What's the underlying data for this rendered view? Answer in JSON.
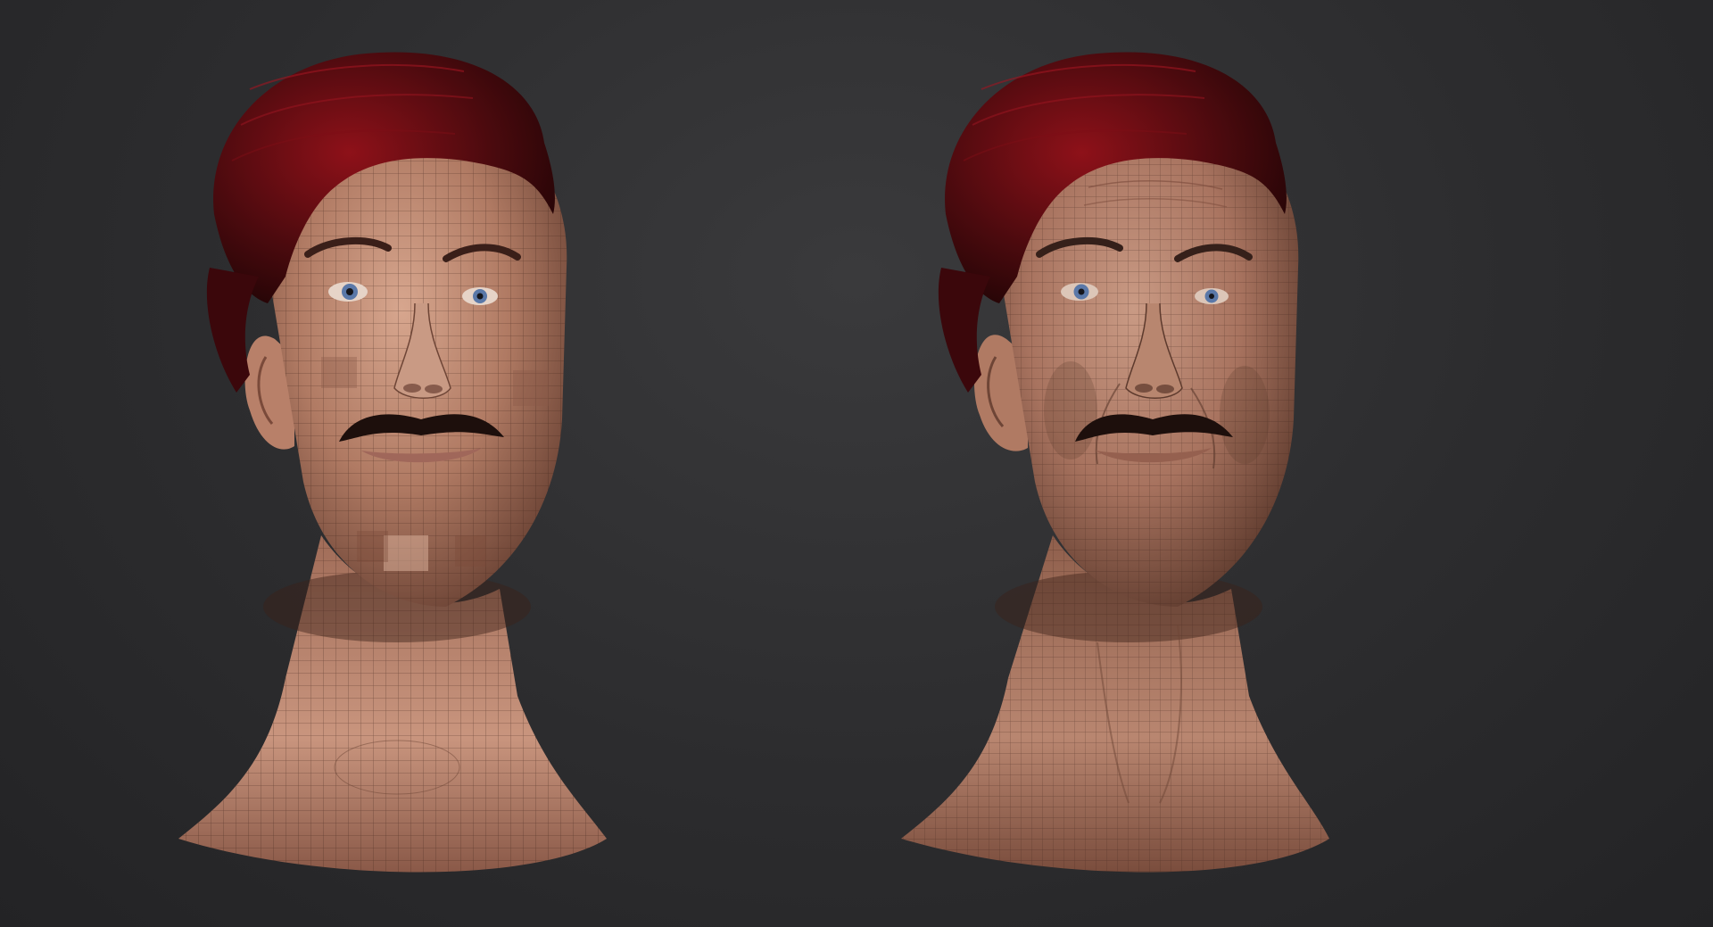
{
  "scene": {
    "background": "#2e2e30",
    "colors": {
      "skin_light": "#c99a84",
      "skin_mid": "#a8735f",
      "skin_dark": "#6e4536",
      "hair": "#4a0a0e",
      "hair_highlight": "#8e1119",
      "mustache": "#1d0f0c",
      "iris": "#5a78a8",
      "wire": "#3a2018"
    },
    "views": [
      {
        "id": "low-res-head",
        "label": ""
      },
      {
        "id": "high-res-head",
        "label": ""
      }
    ]
  }
}
